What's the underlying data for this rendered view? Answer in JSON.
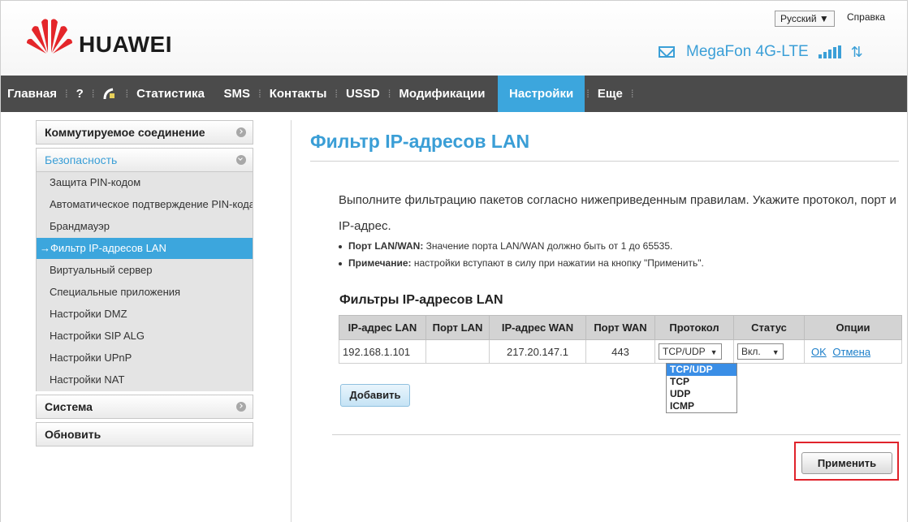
{
  "header": {
    "brand": "HUAWEI",
    "language": "Русский ▼",
    "help": "Справка",
    "operator": "MegaFon 4G-LTE",
    "arrows": "⇅"
  },
  "nav": {
    "items": [
      "Главная",
      "?",
      "Статистика",
      "SMS",
      "Контакты",
      "USSD",
      "Модификации",
      "Настройки",
      "Еще"
    ],
    "active": "Настройки"
  },
  "sidebar": {
    "dialup": "Коммутируемое соединение",
    "security": "Безопасность",
    "security_items": [
      "Защита PIN-кодом",
      "Автоматическое подтверждение PIN-кода",
      "Брандмауэр",
      "→Фильтр IP-адресов LAN",
      "Виртуальный сервер",
      "Специальные приложения",
      "Настройки DMZ",
      "Настройки SIP ALG",
      "Настройки UPnP",
      "Настройки NAT"
    ],
    "system": "Система",
    "update": "Обновить"
  },
  "main": {
    "title": "Фильтр IP-адресов LAN",
    "description": "Выполните фильтрацию пакетов согласно нижеприведенным правилам. Укажите протокол, порт и IP-адрес.",
    "note1_label": "Порт LAN/WAN:",
    "note1_text": " Значение порта LAN/WAN должно быть от 1 до 65535.",
    "note2_label": "Примечание:",
    "note2_text": " настройки вступают в силу при нажатии на кнопку \"Применить\".",
    "subtitle": "Фильтры IP-адресов LAN",
    "table": {
      "headers": [
        "IP-адрес LAN",
        "Порт LAN",
        "IP-адрес WAN",
        "Порт WAN",
        "Протокол",
        "Статус",
        "Опции"
      ],
      "row": {
        "ip_lan": "192.168.1.101",
        "port_lan": "",
        "ip_wan": "217.20.147.1",
        "port_wan": "443",
        "protocol": "TCP/UDP",
        "status": "Вкл.",
        "ok": "OK",
        "cancel": "Отмена"
      }
    },
    "protocol_options": [
      "TCP/UDP",
      "TCP",
      "UDP",
      "ICMP"
    ],
    "add_label": "Добавить",
    "apply_label": "Применить"
  },
  "colors": {
    "accent": "#3ca6dd",
    "nav_bg": "#4b4b4b",
    "highlight": "#e0232b"
  }
}
